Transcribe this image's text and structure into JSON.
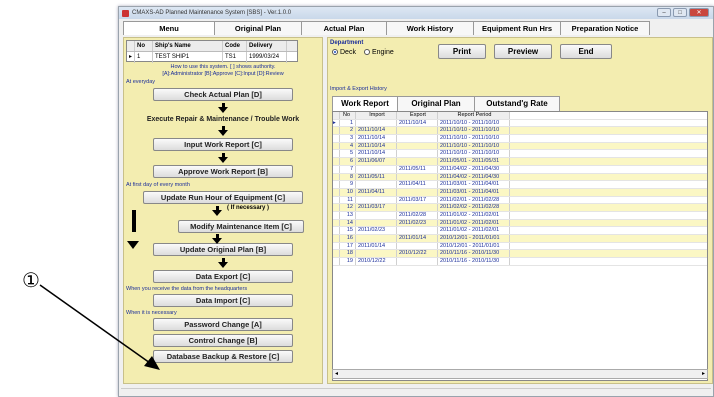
{
  "annotation": {
    "marker": "①"
  },
  "window": {
    "title": "CMAXS-AD Planned Maintenance System [SBS] - Ver.1.0.0"
  },
  "tabs": [
    "Menu",
    "Original Plan",
    "Actual Plan",
    "Work History",
    "Equipment Run Hrs",
    "Preparation Notice"
  ],
  "ships": {
    "headers": [
      "No",
      "Ship's Name",
      "Code",
      "Delivery"
    ],
    "rows": [
      [
        "1",
        "TEST SHIP1",
        "TS1",
        "1999/03/24"
      ]
    ]
  },
  "notes": {
    "how_to": "How to use this system.  [ ] shows authority.",
    "authority": "[A]:Administrator  [B]:Approve  [C]:Input  [D]:Review"
  },
  "sections": {
    "everyday": "At everyday",
    "first_day": "At first day of every month",
    "receive": "When you receive the data from the headquarters",
    "necessary": "When it is necessary"
  },
  "buttons": {
    "check_actual": "Check Actual Plan  [D]",
    "execute": "Execute Repair & Maintenance / Trouble Work",
    "input_report": "Input Work Report  [C]",
    "approve_report": "Approve Work Report  [B]",
    "update_run": "Update Run Hour of Equipment  [C]",
    "if_necessary": "( If necessary )",
    "modify_item": "Modify Maintenance Item  [C]",
    "update_original": "Update Original Plan  [B]",
    "data_export": "Data Export  [C]",
    "data_import": "Data Import  [C]",
    "password": "Password Change  [A]",
    "control": "Control Change  [B]",
    "backup": "Database Backup & Restore  [C]"
  },
  "department": {
    "label": "Department",
    "options": [
      "Deck",
      "Engine"
    ],
    "selected": "Deck"
  },
  "top_buttons": {
    "print": "Print",
    "preview": "Preview",
    "end": "End"
  },
  "history": {
    "label": "Import & Export History",
    "tabs": [
      "Work Report",
      "Original Plan",
      "Outstand'g Rate"
    ],
    "headers": [
      "No",
      "Import",
      "Export",
      "Report Period"
    ],
    "rows": [
      [
        "1",
        "",
        "2011/10/14",
        "2011/10/10 - 2011/10/10"
      ],
      [
        "2",
        "2011/10/14",
        "",
        "2011/10/10 - 2011/10/10"
      ],
      [
        "3",
        "2011/10/14",
        "",
        "2011/10/10 - 2011/10/10"
      ],
      [
        "4",
        "2011/10/14",
        "",
        "2011/10/10 - 2011/10/10"
      ],
      [
        "5",
        "2011/10/14",
        "",
        "2011/10/10 - 2011/10/10"
      ],
      [
        "6",
        "2011/06/07",
        "",
        "2011/05/01 - 2011/05/31"
      ],
      [
        "7",
        "",
        "2011/05/11",
        "2011/04/02 - 2011/04/30"
      ],
      [
        "8",
        "2011/05/11",
        "",
        "2011/04/02 - 2011/04/30"
      ],
      [
        "9",
        "",
        "2011/04/11",
        "2011/03/01 - 2011/04/01"
      ],
      [
        "10",
        "2011/04/11",
        "",
        "2011/03/01 - 2011/04/01"
      ],
      [
        "11",
        "",
        "2011/03/17",
        "2011/02/01 - 2011/02/28"
      ],
      [
        "12",
        "2011/03/17",
        "",
        "2011/02/02 - 2011/02/28"
      ],
      [
        "13",
        "",
        "2011/02/28",
        "2011/01/02 - 2011/02/01"
      ],
      [
        "14",
        "",
        "2011/02/23",
        "2011/01/02 - 2011/02/01"
      ],
      [
        "15",
        "2011/02/23",
        "",
        "2011/01/02 - 2011/02/01"
      ],
      [
        "16",
        "",
        "2011/01/14",
        "2010/12/01 - 2011/01/01"
      ],
      [
        "17",
        "2011/01/14",
        "",
        "2010/12/01 - 2011/01/01"
      ],
      [
        "18",
        "",
        "2010/12/22",
        "2010/11/16 - 2010/11/30"
      ],
      [
        "19",
        "2010/12/22",
        "",
        "2010/11/16 - 2010/11/30"
      ]
    ]
  }
}
